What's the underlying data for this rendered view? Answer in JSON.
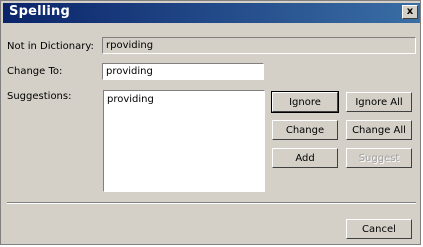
{
  "window": {
    "title": "Spelling",
    "close_glyph": "x"
  },
  "fields": {
    "not_in_dictionary_label": "Not in Dictionary:",
    "not_in_dictionary_value": "rpoviding",
    "change_to_label": "Change To:",
    "change_to_value": "providing",
    "suggestions_label": "Suggestions:"
  },
  "suggestions": [
    "providing"
  ],
  "buttons": {
    "ignore": "Ignore",
    "ignore_all": "Ignore All",
    "change": "Change",
    "change_all": "Change All",
    "add": "Add",
    "suggest": "Suggest",
    "cancel": "Cancel"
  },
  "colors": {
    "title_bar": "#0a246a",
    "dialog_face": "#d4d0c8",
    "disabled_text": "#a0a0a0"
  }
}
